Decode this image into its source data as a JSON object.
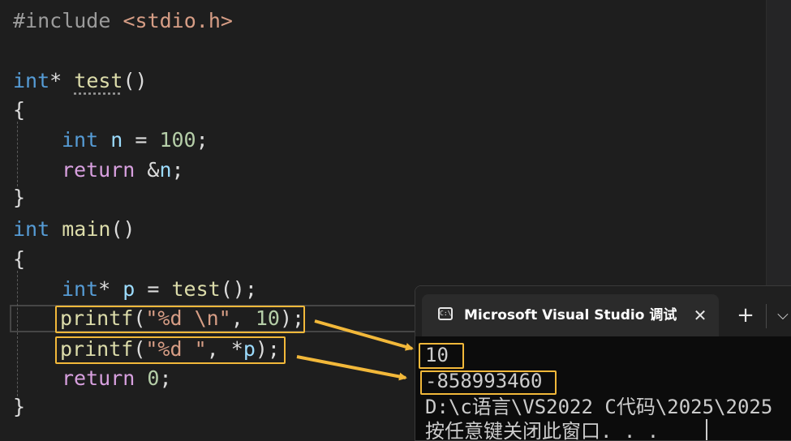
{
  "code": {
    "include": "#include ",
    "include_file": "<stdio.h>",
    "kw_int": "int",
    "star": "*",
    "fn_test": "test",
    "fn_main": "main",
    "parens": "()",
    "open_brace": "{",
    "close_brace": "}",
    "var_n": "n",
    "var_p": "p",
    "eq": " = ",
    "num_100": "100",
    "num_10": "10",
    "num_0": "0",
    "semi": ";",
    "kw_return": "return",
    "amp": "&",
    "fn_printf": "printf",
    "open_paren": "(",
    "close_paren_semi": ");",
    "call_semi": "();",
    "str_1": "\"%d \\n\"",
    "str_2": "\"%d \"",
    "comma": ", "
  },
  "terminal": {
    "title": "Microsoft Visual Studio 调试控制台",
    "icon_text": "C:\\",
    "close_glyph": "✕",
    "new_tab_glyph": "+",
    "dropdown_glyph": "⌵",
    "output": [
      "10",
      "-858993460",
      "D:\\c语言\\VS2022 C代码\\2025\\2025",
      "按任意键关闭此窗口. . ."
    ]
  },
  "colors": {
    "highlight": "#f2b83a",
    "keyword": "#569cd6",
    "function": "#dcdcaa",
    "string": "#d69d85"
  }
}
